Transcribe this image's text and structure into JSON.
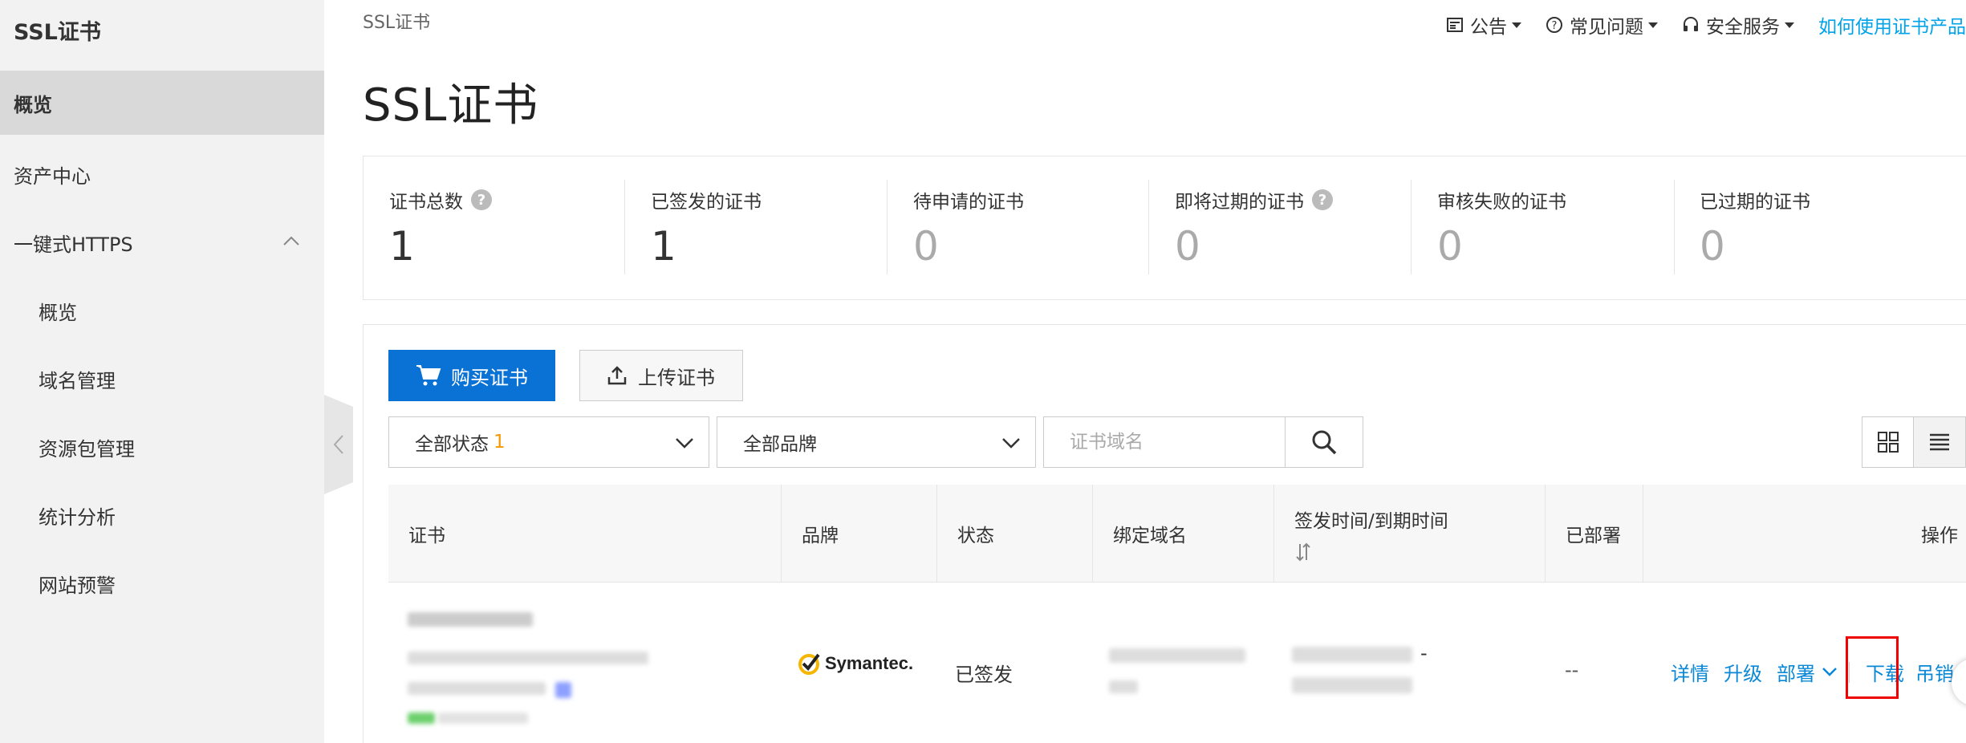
{
  "sidebar": {
    "title": "SSL证书",
    "items": [
      {
        "label": "概览",
        "active": true
      },
      {
        "label": "资产中心"
      },
      {
        "label": "一键式HTTPS",
        "expanded": true
      },
      {
        "label": "概览",
        "sub": true
      },
      {
        "label": "域名管理",
        "sub": true
      },
      {
        "label": "资源包管理",
        "sub": true
      },
      {
        "label": "统计分析",
        "sub": true
      },
      {
        "label": "网站预警",
        "sub": true
      }
    ]
  },
  "breadcrumb": "SSL证书",
  "topnav": {
    "announcement": "公告",
    "faq": "常见问题",
    "security": "安全服务",
    "help_link": "如何使用证书产品"
  },
  "page_title": "SSL证书",
  "stats": [
    {
      "label": "证书总数",
      "value": "1",
      "help": true
    },
    {
      "label": "已签发的证书",
      "value": "1"
    },
    {
      "label": "待申请的证书",
      "value": "0"
    },
    {
      "label": "即将过期的证书",
      "value": "0",
      "help": true
    },
    {
      "label": "审核失败的证书",
      "value": "0"
    },
    {
      "label": "已过期的证书",
      "value": "0"
    }
  ],
  "toolbar": {
    "buy_label": "购买证书",
    "upload_label": "上传证书"
  },
  "filters": {
    "status_label": "全部状态",
    "status_count": "1",
    "brand_label": "全部品牌",
    "search_placeholder": "证书域名"
  },
  "table": {
    "columns": [
      "证书",
      "品牌",
      "状态",
      "绑定域名",
      "签发时间/到期时间",
      "已部署",
      "操作"
    ],
    "rows": [
      {
        "brand": "Symantec.",
        "status": "已签发",
        "deployed": "--",
        "date_separator": "-",
        "actions": [
          "详情",
          "升级",
          "部署",
          "下载",
          "吊销"
        ]
      }
    ]
  },
  "colors": {
    "primary": "#0a72d4",
    "link": "#0a88d6",
    "help_link": "#00a2e8",
    "count_badge": "#f39800",
    "highlight": "#ee0000"
  }
}
